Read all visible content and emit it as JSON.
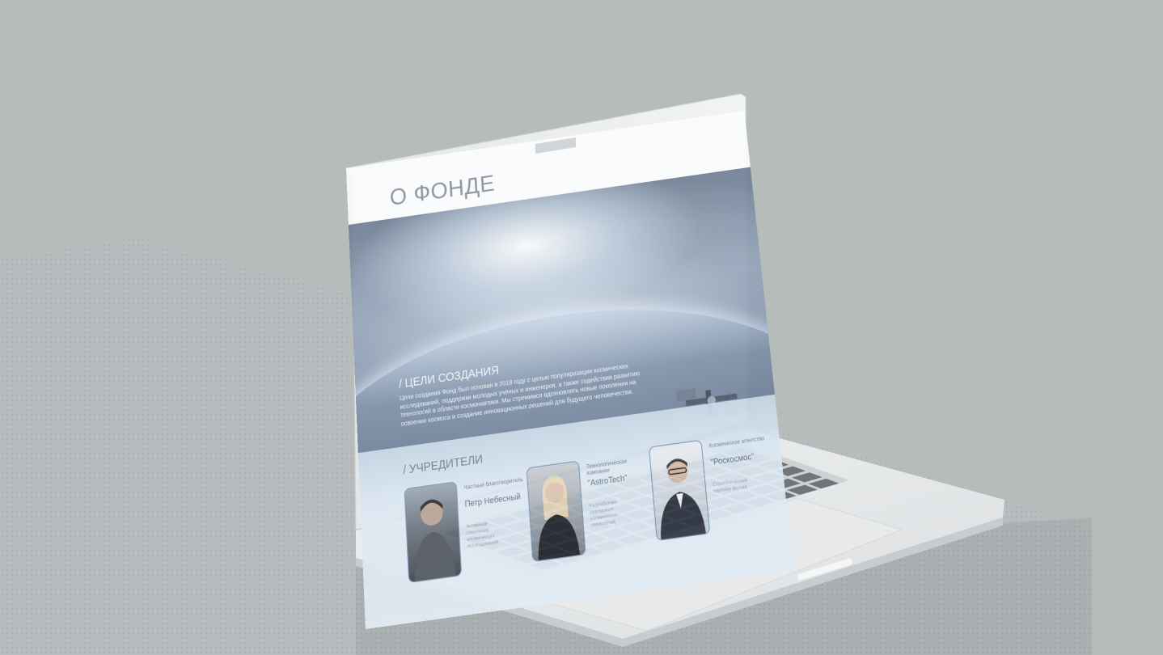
{
  "page": {
    "title": "О ФОНДЕ"
  },
  "goals": {
    "heading": "/ ЦЕЛИ СОЗДАНИЯ",
    "text": "Цели создания Фонд был основан в 2018 году с целью популяризации космических исследований, поддержки молодых учёных и инженеров, а также содействия развитию технологий в области космонавтики. Мы стремимся вдохновлять новые поколения на освоение космоса и создание инновационных решений для будущего человечества."
  },
  "founders": {
    "heading": "/ УЧРЕДИТЕЛИ",
    "items": [
      {
        "role": "Частный благотворитель",
        "name": "Петр Небесный",
        "desc": "Активный сторонник космических исследований"
      },
      {
        "role": "Технологическая компания",
        "name": "\"AstroTech\"",
        "desc": "Разработчик передовых космических технологий"
      },
      {
        "role": "Космическое агентство",
        "name": "\"Роскосмос\"",
        "desc": "Стратегический партнёр фонда"
      }
    ]
  },
  "colors": {
    "background": "#b5bcb9",
    "accent": "#7b96b8"
  }
}
